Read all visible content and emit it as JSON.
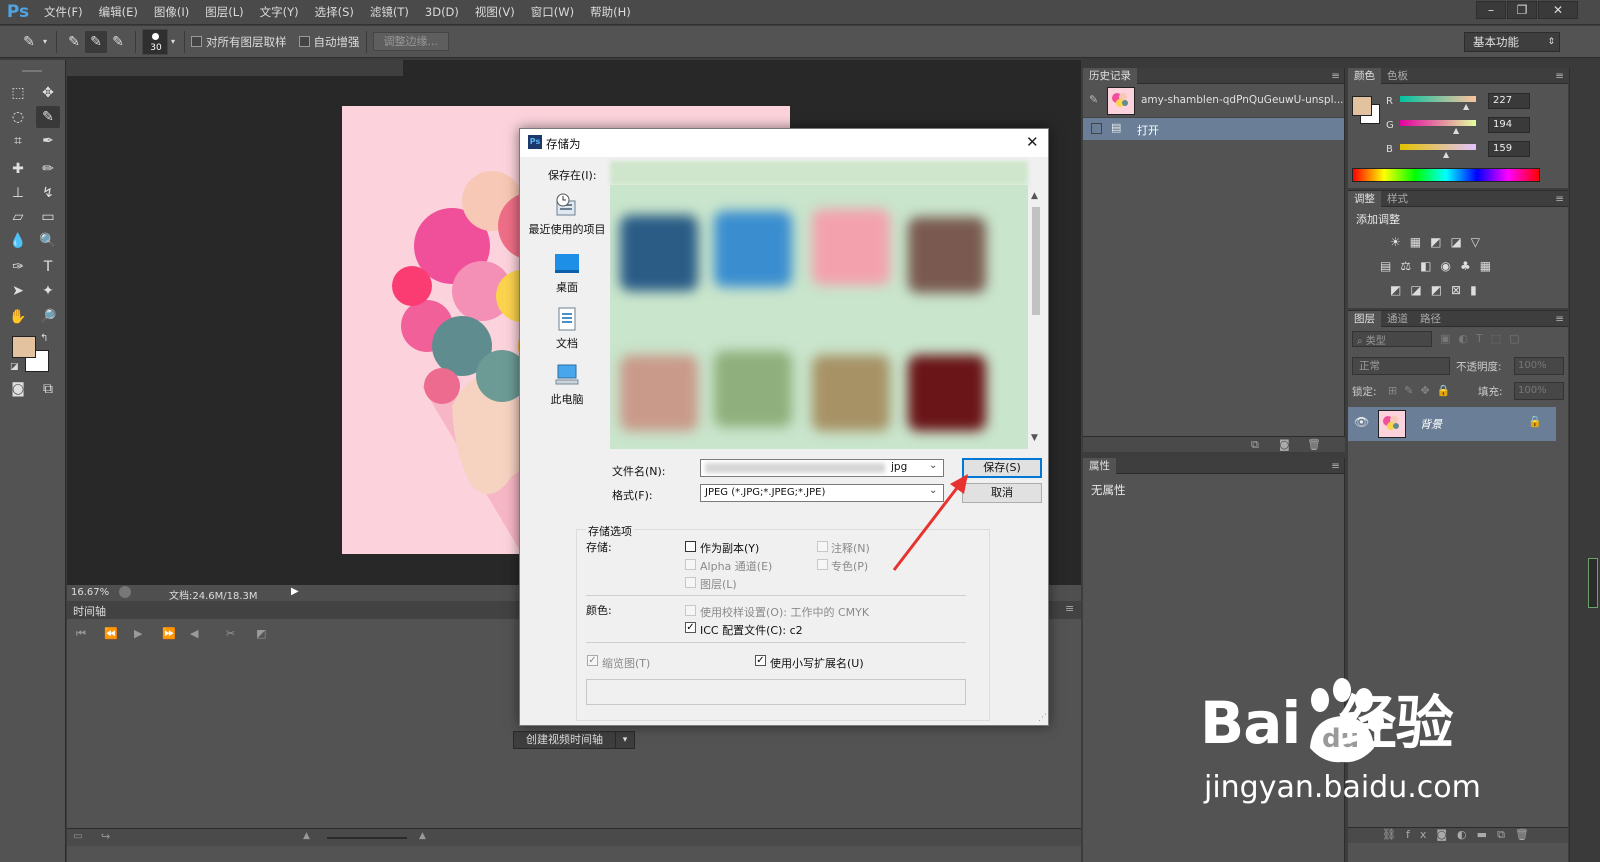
{
  "app": {
    "logo": "Ps",
    "menu": [
      "文件(F)",
      "编辑(E)",
      "图像(I)",
      "图层(L)",
      "文字(Y)",
      "选择(S)",
      "滤镜(T)",
      "3D(D)",
      "视图(V)",
      "窗口(W)",
      "帮助(H)"
    ],
    "workspace": "基本功能"
  },
  "options_bar": {
    "brush_size": "30",
    "sample_all_layers": "对所有图层取样",
    "auto_enhance": "自动增强",
    "refine_edge": "调整边缘..."
  },
  "colors": {
    "foreground": "#e3c29f",
    "background": "#ffffff",
    "accent": "#0078d7",
    "panel": "#535353"
  },
  "status": {
    "zoom": "16.67%",
    "doc_size": "文档:24.6M/18.3M"
  },
  "timeline": {
    "tab": "时间轴",
    "create_button": "创建视频时间轴"
  },
  "history_panel": {
    "tab": "历史记录",
    "snapshot_name": "amy-shamblen-qdPnQuGeuwU-unspl...",
    "step": "打开"
  },
  "color_panel": {
    "tabs": [
      "颜色",
      "色板"
    ],
    "r_label": "R",
    "g_label": "G",
    "b_label": "B",
    "r": "227",
    "g": "194",
    "b": "159"
  },
  "adjust_panel": {
    "tabs": [
      "调整",
      "样式"
    ],
    "title": "添加调整"
  },
  "layers_panel": {
    "tabs": [
      "图层",
      "通道",
      "路径"
    ],
    "filter": "类型",
    "blend_mode": "正常",
    "opacity_label": "不透明度:",
    "opacity": "100%",
    "lock_label": "锁定:",
    "fill_label": "填充:",
    "fill": "100%",
    "layer_name": "背景"
  },
  "properties_panel": {
    "tab": "属性",
    "content": "无属性"
  },
  "dialog": {
    "title": "存储为",
    "save_in_label": "保存在(I):",
    "places": [
      "最近使用的项目",
      "桌面",
      "文档",
      "此电脑"
    ],
    "filename_label": "文件名(N):",
    "filename_ext": "jpg",
    "format_label": "格式(F):",
    "format_value": "JPEG (*.JPG;*.JPEG;*.JPE)",
    "save_button": "保存(S)",
    "cancel_button": "取消",
    "options_title": "存储选项",
    "save_label": "存储:",
    "as_copy": "作为副本(Y)",
    "annotations": "注释(N)",
    "alpha": "Alpha 通道(E)",
    "spot": "专色(P)",
    "layers": "图层(L)",
    "color_label": "颜色:",
    "proof": "使用校样设置(O):  工作中的 CMYK",
    "icc": "ICC 配置文件(C):  c2",
    "thumbnail": "缩览图(T)",
    "lowercase": "使用小写扩展名(U)"
  },
  "watermark": {
    "brand": "Bai  经验",
    "paw_text": "du",
    "url": "jingyan.baidu.com"
  }
}
